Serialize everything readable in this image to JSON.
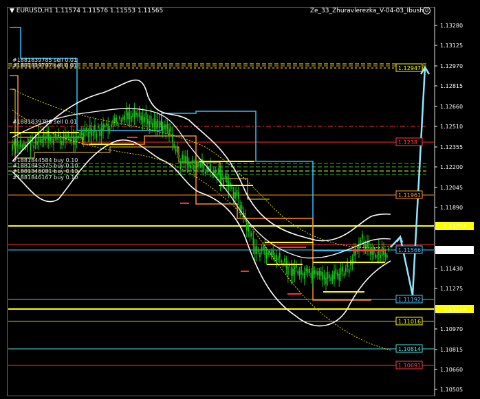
{
  "header": {
    "symbol_line": "▼ EURUSD,H1  1.11574 1.11576 1.11553 1.11565",
    "expert_name": "Ze_33_Zhuravlerezka_V-04-03_Ibush",
    "smiley_icon": "smiley-icon"
  },
  "axis_ticks": [
    "1.13280",
    "1.13125",
    "1.12970",
    "1.12815",
    "1.12660",
    "1.12510",
    "1.12355",
    "1.12200",
    "1.12045",
    "1.11890",
    "1.11740",
    "1.11585",
    "1.11430",
    "1.11275",
    "1.11120",
    "1.10970",
    "1.10815",
    "1.10660",
    "1.10505"
  ],
  "axis_markers": [
    {
      "price": "1.11734",
      "bg": "#ffff00",
      "fg": "#000000"
    },
    {
      "price": "1.11565",
      "bg": "#ffffff",
      "fg": "#000000"
    },
    {
      "price": "1.11118",
      "bg": "#ffff00",
      "fg": "#000000"
    }
  ],
  "level_labels": [
    {
      "text": "1.12947",
      "color": "#ffff00"
    },
    {
      "text": "1.1238",
      "color": "#ff4040"
    },
    {
      "text": "1.11961",
      "color": "#ff9a2e"
    },
    {
      "text": "1.11566",
      "color": "#48c8ff"
    },
    {
      "text": "1.11192",
      "color": "#48c8ff"
    },
    {
      "text": "1.11016",
      "color": "#ffff00"
    },
    {
      "text": "1.10814",
      "color": "#48e0e0"
    },
    {
      "text": "1.10691",
      "color": "#ff4040"
    }
  ],
  "orders": [
    "#1881839785 sell 0.01",
    "#1881839797 sell 0.01",
    "#1881839796 sell 0.01",
    "#1881844584 buy 0.10",
    "#1881845375 buy 0.10",
    "#1881846081 buy 0.10",
    "#1881846167 buy 0.10"
  ],
  "colors": {
    "background": "#000000",
    "candles": "#19c419",
    "bands": "#ffffff",
    "cyan_channel": "#2ec4ff",
    "orange_channel": "#ff8c1a",
    "yellow": "#ffff00",
    "red": "#ff3030"
  }
}
